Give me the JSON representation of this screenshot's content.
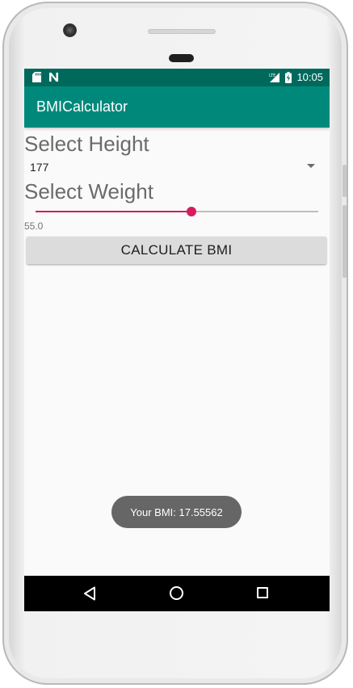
{
  "status_bar": {
    "time": "10:05",
    "icons": [
      "sd-card-icon",
      "n-notification-icon",
      "lte-signal-icon",
      "battery-charging-icon"
    ]
  },
  "app_bar": {
    "title": "BMICalculator"
  },
  "height": {
    "label": "Select Height",
    "selected_value": "177"
  },
  "weight": {
    "label": "Select Weight",
    "slider_fraction": 0.55,
    "value_text": "55.0"
  },
  "calculate_button": {
    "label": "CALCULATE BMI"
  },
  "toast": {
    "text": "Your BMI: 17.55562"
  },
  "nav_bar": {
    "icons": [
      "back-icon",
      "home-icon",
      "recent-apps-icon"
    ]
  },
  "colors": {
    "status_bar": "#00695c",
    "app_bar": "#00897b",
    "accent": "#d81b60",
    "background": "#fafafa",
    "toast": "#666666"
  }
}
